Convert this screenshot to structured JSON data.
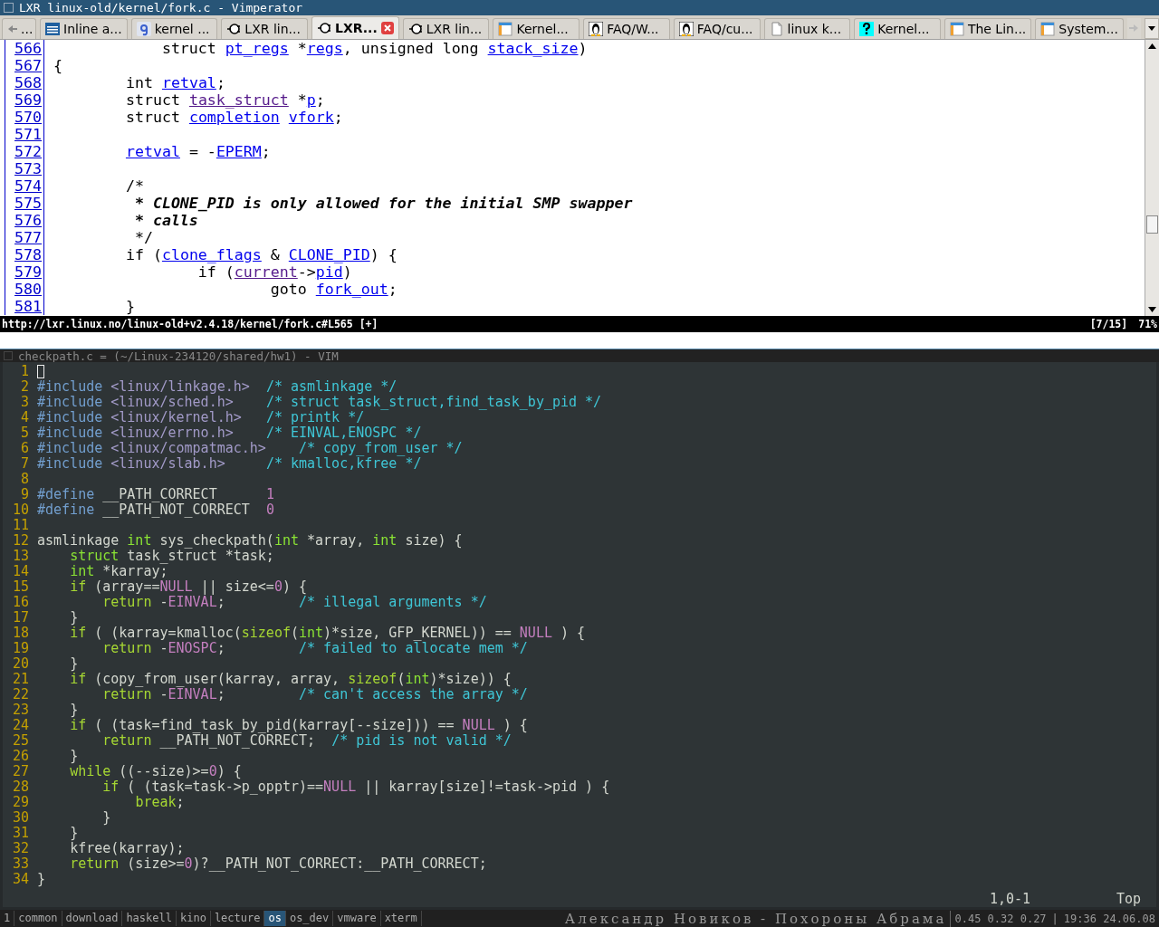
{
  "window": {
    "title": "LXR linux-old/kernel/fork.c - Vimperator"
  },
  "browser_tabs": [
    {
      "label": "...",
      "kind": "back",
      "selected": false
    },
    {
      "label": "Inline a...",
      "kind": "ibm",
      "selected": false
    },
    {
      "label": "kernel ...",
      "kind": "g",
      "selected": false
    },
    {
      "label": "LXR lin...",
      "kind": "lxr",
      "selected": false
    },
    {
      "label": "LXR...",
      "kind": "lxr",
      "selected": true
    },
    {
      "label": "LXR lin...",
      "kind": "lxr",
      "selected": false
    },
    {
      "label": "Kernel...",
      "kind": "window",
      "selected": false
    },
    {
      "label": "FAQ/W...",
      "kind": "penguin",
      "selected": false
    },
    {
      "label": "FAQ/cu...",
      "kind": "penguin",
      "selected": false
    },
    {
      "label": "linux k...",
      "kind": "page",
      "selected": false
    },
    {
      "label": "Kernel...",
      "kind": "question",
      "selected": false
    },
    {
      "label": "The Lin...",
      "kind": "window",
      "selected": false
    },
    {
      "label": "System...",
      "kind": "window",
      "selected": false
    }
  ],
  "page": {
    "lines": [
      {
        "number": "566",
        "segments": [
          {
            "text": "            struct ",
            "kind": "plain"
          },
          {
            "text": "pt_regs",
            "kind": "link"
          },
          {
            "text": " *",
            "kind": "plain"
          },
          {
            "text": "regs",
            "kind": "link"
          },
          {
            "text": ", unsigned long ",
            "kind": "plain"
          },
          {
            "text": "stack_size",
            "kind": "link"
          },
          {
            "text": ")",
            "kind": "plain"
          }
        ]
      },
      {
        "number": "567",
        "segments": [
          {
            "text": "{",
            "kind": "plain"
          }
        ]
      },
      {
        "number": "568",
        "segments": [
          {
            "text": "        int ",
            "kind": "plain"
          },
          {
            "text": "retval",
            "kind": "link"
          },
          {
            "text": ";",
            "kind": "plain"
          }
        ]
      },
      {
        "number": "569",
        "segments": [
          {
            "text": "        struct ",
            "kind": "plain"
          },
          {
            "text": "task_struct",
            "kind": "visited"
          },
          {
            "text": " *",
            "kind": "plain"
          },
          {
            "text": "p",
            "kind": "link"
          },
          {
            "text": ";",
            "kind": "plain"
          }
        ]
      },
      {
        "number": "570",
        "segments": [
          {
            "text": "        struct ",
            "kind": "plain"
          },
          {
            "text": "completion",
            "kind": "link"
          },
          {
            "text": " vfork",
            "kind": "link"
          },
          {
            "text": ";",
            "kind": "plain"
          }
        ]
      },
      {
        "number": "571"
      },
      {
        "number": "572",
        "segments": [
          {
            "text": "        retval",
            "kind": "link"
          },
          {
            "text": " = -",
            "kind": "plain"
          },
          {
            "text": "EPERM",
            "kind": "link"
          },
          {
            "text": ";",
            "kind": "plain"
          }
        ]
      },
      {
        "number": "573"
      },
      {
        "number": "574",
        "segments": [
          {
            "text": "        /*",
            "kind": "plain"
          }
        ]
      },
      {
        "number": "575",
        "segments": [
          {
            "text": "         * CLONE_PID is only allowed for the initial SMP swapper",
            "kind": "comment"
          }
        ]
      },
      {
        "number": "576",
        "segments": [
          {
            "text": "         * calls",
            "kind": "comment"
          }
        ]
      },
      {
        "number": "577",
        "segments": [
          {
            "text": "         */",
            "kind": "plain"
          }
        ]
      },
      {
        "number": "578",
        "segments": [
          {
            "text": "        if (",
            "kind": "plain"
          },
          {
            "text": "clone_flags",
            "kind": "link"
          },
          {
            "text": " & ",
            "kind": "plain"
          },
          {
            "text": "CLONE_PID",
            "kind": "link"
          },
          {
            "text": ") {",
            "kind": "plain"
          }
        ]
      },
      {
        "number": "579",
        "segments": [
          {
            "text": "                if (",
            "kind": "plain"
          },
          {
            "text": "current",
            "kind": "visited"
          },
          {
            "text": "->",
            "kind": "plain"
          },
          {
            "text": "pid",
            "kind": "link"
          },
          {
            "text": ")",
            "kind": "plain"
          }
        ]
      },
      {
        "number": "580",
        "segments": [
          {
            "text": "                        goto ",
            "kind": "plain"
          },
          {
            "text": "fork_out",
            "kind": "link"
          },
          {
            "text": ";",
            "kind": "plain"
          }
        ]
      },
      {
        "number": "581",
        "segments": [
          {
            "text": "        }",
            "kind": "plain"
          }
        ]
      }
    ]
  },
  "browser_status": {
    "url": "http://lxr.linux.no/linux-old+v2.4.18/kernel/fork.c#L565 [+]",
    "position": "[7/15]",
    "percent": "71%"
  },
  "vim": {
    "title": "checkpath.c = (~/Linux-234120/shared/hw1) - VIM",
    "lines": [
      {
        "number": "1",
        "cursor": true
      },
      {
        "number": "2",
        "cursor": false,
        "segments": [
          {
            "text": "#include",
            "kind": "preproc"
          },
          {
            "text": " <linux/linkage.h>",
            "kind": "include"
          },
          {
            "text": "  /* asmlinkage */",
            "kind": "comment"
          }
        ]
      },
      {
        "number": "3",
        "cursor": false,
        "segments": [
          {
            "text": "#include",
            "kind": "preproc"
          },
          {
            "text": " <linux/sched.h>",
            "kind": "include"
          },
          {
            "text": "    /* struct task_struct,find_task_by_pid */",
            "kind": "comment"
          }
        ]
      },
      {
        "number": "4",
        "cursor": false,
        "segments": [
          {
            "text": "#include",
            "kind": "preproc"
          },
          {
            "text": " <linux/kernel.h>",
            "kind": "include"
          },
          {
            "text": "   /* printk */",
            "kind": "comment"
          }
        ]
      },
      {
        "number": "5",
        "cursor": false,
        "segments": [
          {
            "text": "#include",
            "kind": "preproc"
          },
          {
            "text": " <linux/errno.h>",
            "kind": "include"
          },
          {
            "text": "    /* EINVAL,ENOSPC */",
            "kind": "comment"
          }
        ]
      },
      {
        "number": "6",
        "cursor": false,
        "segments": [
          {
            "text": "#include",
            "kind": "preproc"
          },
          {
            "text": " <linux/compatmac.h>",
            "kind": "include"
          },
          {
            "text": "    /* copy_from_user */",
            "kind": "comment"
          }
        ]
      },
      {
        "number": "7",
        "cursor": false,
        "segments": [
          {
            "text": "#include",
            "kind": "preproc"
          },
          {
            "text": " <linux/slab.h>",
            "kind": "include"
          },
          {
            "text": "     /* kmalloc,kfree */",
            "kind": "comment"
          }
        ]
      },
      {
        "number": "8",
        "cursor": false
      },
      {
        "number": "9",
        "cursor": false,
        "segments": [
          {
            "text": "#define",
            "kind": "preproc"
          },
          {
            "text": " __PATH_CORRECT      ",
            "kind": "normal"
          },
          {
            "text": "1",
            "kind": "constant"
          }
        ]
      },
      {
        "number": "10",
        "cursor": false,
        "segments": [
          {
            "text": "#define",
            "kind": "preproc"
          },
          {
            "text": " __PATH_NOT_CORRECT  ",
            "kind": "normal"
          },
          {
            "text": "0",
            "kind": "constant"
          }
        ]
      },
      {
        "number": "11",
        "cursor": false
      },
      {
        "number": "12",
        "cursor": false,
        "segments": [
          {
            "text": "asmlinkage ",
            "kind": "normal"
          },
          {
            "text": "int",
            "kind": "type"
          },
          {
            "text": " sys_checkpath(",
            "kind": "normal"
          },
          {
            "text": "int",
            "kind": "type"
          },
          {
            "text": " *array, ",
            "kind": "normal"
          },
          {
            "text": "int",
            "kind": "type"
          },
          {
            "text": " size) {",
            "kind": "normal"
          }
        ]
      },
      {
        "number": "13",
        "cursor": false,
        "segments": [
          {
            "text": "    struct",
            "kind": "type"
          },
          {
            "text": " task_struct *task;",
            "kind": "normal"
          }
        ]
      },
      {
        "number": "14",
        "cursor": false,
        "segments": [
          {
            "text": "    int",
            "kind": "type"
          },
          {
            "text": " *karray;",
            "kind": "normal"
          }
        ]
      },
      {
        "number": "15",
        "cursor": false,
        "segments": [
          {
            "text": "    if",
            "kind": "statement"
          },
          {
            "text": " (array==",
            "kind": "normal"
          },
          {
            "text": "NULL",
            "kind": "constant"
          },
          {
            "text": " || size<=",
            "kind": "normal"
          },
          {
            "text": "0",
            "kind": "constant"
          },
          {
            "text": ") {",
            "kind": "normal"
          }
        ]
      },
      {
        "number": "16",
        "cursor": false,
        "segments": [
          {
            "text": "        return",
            "kind": "statement"
          },
          {
            "text": " -",
            "kind": "normal"
          },
          {
            "text": "EINVAL",
            "kind": "constant"
          },
          {
            "text": ";",
            "kind": "normal"
          },
          {
            "text": "         /* illegal arguments */",
            "kind": "comment"
          }
        ]
      },
      {
        "number": "17",
        "cursor": false,
        "segments": [
          {
            "text": "    }",
            "kind": "normal"
          }
        ]
      },
      {
        "number": "18",
        "cursor": false,
        "segments": [
          {
            "text": "    if",
            "kind": "statement"
          },
          {
            "text": " ( (karray=kmalloc(",
            "kind": "normal"
          },
          {
            "text": "sizeof",
            "kind": "statement"
          },
          {
            "text": "(",
            "kind": "normal"
          },
          {
            "text": "int",
            "kind": "type"
          },
          {
            "text": ")*size, GFP_KERNEL)) == ",
            "kind": "normal"
          },
          {
            "text": "NULL",
            "kind": "constant"
          },
          {
            "text": " ) {",
            "kind": "normal"
          }
        ]
      },
      {
        "number": "19",
        "cursor": false,
        "segments": [
          {
            "text": "        return",
            "kind": "statement"
          },
          {
            "text": " -",
            "kind": "normal"
          },
          {
            "text": "ENOSPC",
            "kind": "constant"
          },
          {
            "text": ";",
            "kind": "normal"
          },
          {
            "text": "         /* failed to allocate mem */",
            "kind": "comment"
          }
        ]
      },
      {
        "number": "20",
        "cursor": false,
        "segments": [
          {
            "text": "    }",
            "kind": "normal"
          }
        ]
      },
      {
        "number": "21",
        "cursor": false,
        "segments": [
          {
            "text": "    if",
            "kind": "statement"
          },
          {
            "text": " (copy_from_user(karray, array, ",
            "kind": "normal"
          },
          {
            "text": "sizeof",
            "kind": "statement"
          },
          {
            "text": "(",
            "kind": "normal"
          },
          {
            "text": "int",
            "kind": "type"
          },
          {
            "text": ")*size)) {",
            "kind": "normal"
          }
        ]
      },
      {
        "number": "22",
        "cursor": false,
        "segments": [
          {
            "text": "        return",
            "kind": "statement"
          },
          {
            "text": " -",
            "kind": "normal"
          },
          {
            "text": "EINVAL",
            "kind": "constant"
          },
          {
            "text": ";",
            "kind": "normal"
          },
          {
            "text": "         /* can't access the array */",
            "kind": "comment"
          }
        ]
      },
      {
        "number": "23",
        "cursor": false,
        "segments": [
          {
            "text": "    }",
            "kind": "normal"
          }
        ]
      },
      {
        "number": "24",
        "cursor": false,
        "segments": [
          {
            "text": "    if",
            "kind": "statement"
          },
          {
            "text": " ( (task=find_task_by_pid(karray[--size])) == ",
            "kind": "normal"
          },
          {
            "text": "NULL",
            "kind": "constant"
          },
          {
            "text": " ) {",
            "kind": "normal"
          }
        ]
      },
      {
        "number": "25",
        "cursor": false,
        "segments": [
          {
            "text": "        return",
            "kind": "statement"
          },
          {
            "text": " __PATH_NOT_CORRECT;",
            "kind": "normal"
          },
          {
            "text": "  /* pid is not valid */",
            "kind": "comment"
          }
        ]
      },
      {
        "number": "26",
        "cursor": false,
        "segments": [
          {
            "text": "    }",
            "kind": "normal"
          }
        ]
      },
      {
        "number": "27",
        "cursor": false,
        "segments": [
          {
            "text": "    while",
            "kind": "statement"
          },
          {
            "text": " ((--size)>=",
            "kind": "normal"
          },
          {
            "text": "0",
            "kind": "constant"
          },
          {
            "text": ") {",
            "kind": "normal"
          }
        ]
      },
      {
        "number": "28",
        "cursor": false,
        "segments": [
          {
            "text": "        if",
            "kind": "statement"
          },
          {
            "text": " ( (task=task->p_opptr)==",
            "kind": "normal"
          },
          {
            "text": "NULL",
            "kind": "constant"
          },
          {
            "text": " || karray[size]!=task->pid ) {",
            "kind": "normal"
          }
        ]
      },
      {
        "number": "29",
        "cursor": false,
        "segments": [
          {
            "text": "            break",
            "kind": "statement"
          },
          {
            "text": ";",
            "kind": "normal"
          }
        ]
      },
      {
        "number": "30",
        "cursor": false,
        "segments": [
          {
            "text": "        }",
            "kind": "normal"
          }
        ]
      },
      {
        "number": "31",
        "cursor": false,
        "segments": [
          {
            "text": "    }",
            "kind": "normal"
          }
        ]
      },
      {
        "number": "32",
        "cursor": false,
        "segments": [
          {
            "text": "    kfree(karray);",
            "kind": "normal"
          }
        ]
      },
      {
        "number": "33",
        "cursor": false,
        "segments": [
          {
            "text": "    return",
            "kind": "statement"
          },
          {
            "text": " (size>=",
            "kind": "normal"
          },
          {
            "text": "0",
            "kind": "constant"
          },
          {
            "text": ")?__PATH_NOT_CORRECT:__PATH_CORRECT;",
            "kind": "normal"
          }
        ]
      },
      {
        "number": "34",
        "cursor": false,
        "segments": [
          {
            "text": "}",
            "kind": "normal"
          }
        ]
      }
    ],
    "ruler": "1,0-1",
    "scroll_position": "Top"
  },
  "taskbar": {
    "layout": "1",
    "workspaces": [
      {
        "label": "common",
        "selected": false
      },
      {
        "label": "download",
        "selected": false
      },
      {
        "label": "haskell",
        "selected": false
      },
      {
        "label": "kino",
        "selected": false
      },
      {
        "label": "lecture",
        "selected": false
      },
      {
        "label": "os",
        "selected": true
      },
      {
        "label": "os_dev",
        "selected": false
      },
      {
        "label": "vmware",
        "selected": false
      },
      {
        "label": "xterm",
        "selected": false
      }
    ],
    "now_playing": "Александр Новиков - Похороны Абрама",
    "load": "0.45 0.32 0.27",
    "separator": "|",
    "clock": "19:36 24.06.08"
  }
}
